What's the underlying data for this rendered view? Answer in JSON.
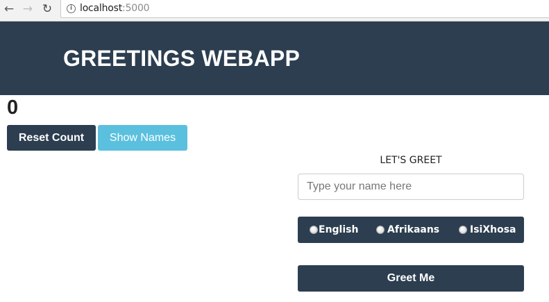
{
  "browser": {
    "url_host": "localhost",
    "url_port": ":5000",
    "icons": {
      "back": "back-arrow-icon",
      "forward": "forward-arrow-icon",
      "reload": "reload-icon",
      "info": "info-icon"
    }
  },
  "header": {
    "title": "GREETINGS WEBAPP"
  },
  "counter": {
    "value": "0"
  },
  "buttons": {
    "reset_label": "Reset Count",
    "show_names_label": "Show Names"
  },
  "greet": {
    "heading": "LET'S GREET",
    "name_input": {
      "value": "",
      "placeholder": "Type your name here"
    },
    "languages": [
      {
        "label": "English",
        "selected": false
      },
      {
        "label": "Afrikaans",
        "selected": false
      },
      {
        "label": "IsiXhosa",
        "selected": false
      }
    ],
    "submit_label": "Greet Me"
  },
  "colors": {
    "primary": "#2c3e50",
    "info_button": "#5bc0de",
    "text_on_dark": "#ffffff"
  }
}
